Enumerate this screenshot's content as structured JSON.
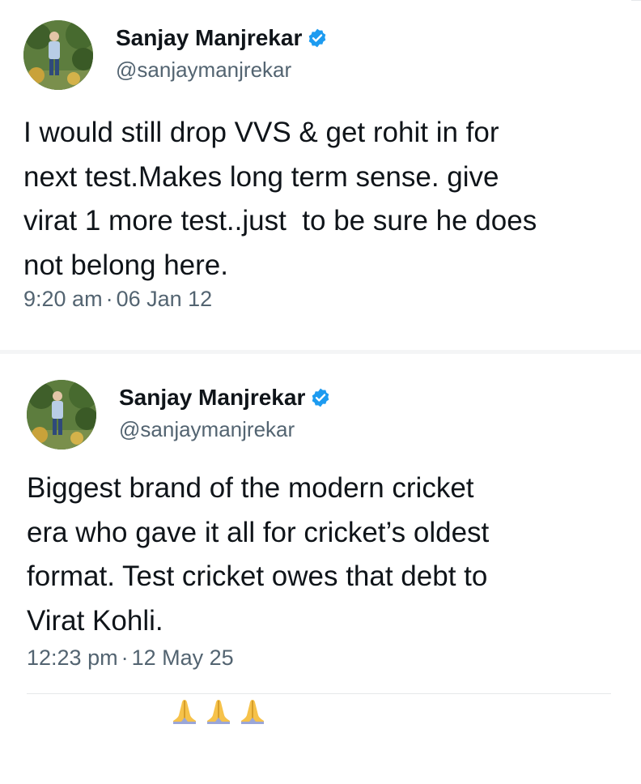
{
  "tweets": [
    {
      "author_name": "Sanjay Manjrekar",
      "handle": "@sanjaymanjrekar",
      "verified_icon": "verified-badge-icon",
      "text": "I would still drop VVS & get rohit in for\nnext test.Makes long term sense. give\nvirat 1 more test..just  to be sure he does\nnot belong here.",
      "time": "9:20 am",
      "separator": "·",
      "date": "06 Jan 12"
    },
    {
      "author_name": "Sanjay Manjrekar",
      "handle": "@sanjaymanjrekar",
      "verified_icon": "verified-badge-icon",
      "text": "Biggest brand of the modern cricket\nera who gave it all for cricket’s oldest\nformat. Test cricket owes that debt to\nVirat Kohli.",
      "emoji": [
        "🙏",
        "🙏",
        "🙏"
      ],
      "time": "12:23 pm",
      "separator": "·",
      "date": "12 May 25"
    }
  ],
  "colors": {
    "text": "#0f1419",
    "secondary": "#536471",
    "verified_blue": "#1d9bf0",
    "divider": "#e6e8ea"
  }
}
